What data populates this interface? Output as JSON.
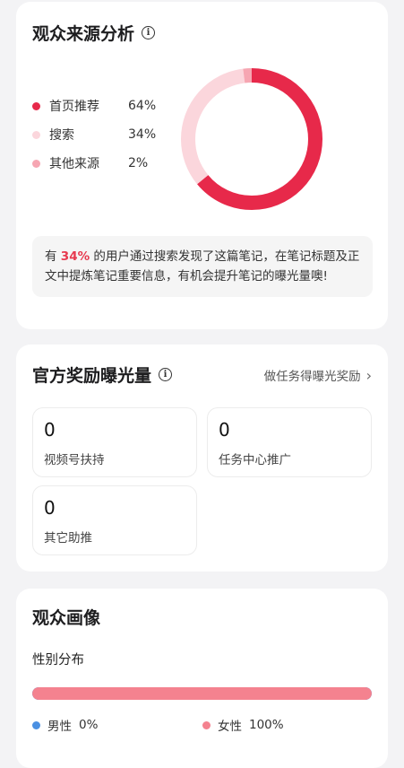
{
  "audience_source": {
    "title": "观众来源分析",
    "items": [
      {
        "label": "首页推荐",
        "value": "64%",
        "color": "#e7294a"
      },
      {
        "label": "搜索",
        "value": "34%",
        "color": "#fbd6dc"
      },
      {
        "label": "其他来源",
        "value": "2%",
        "color": "#f6a6b2"
      }
    ],
    "note": {
      "prefix": "有 ",
      "highlight": "34%",
      "suffix": " 的用户通过搜索发现了这篇笔记，在笔记标题及正文中提炼笔记重要信息，有机会提升笔记的曝光量噢!"
    }
  },
  "chart_data": {
    "type": "pie",
    "categories": [
      "首页推荐",
      "搜索",
      "其他来源"
    ],
    "values": [
      64,
      34,
      2
    ],
    "colors": [
      "#e7294a",
      "#fbd6dc",
      "#f6a6b2"
    ]
  },
  "official_reward": {
    "title": "官方奖励曝光量",
    "link": "做任务得曝光奖励",
    "stats": [
      {
        "value": "0",
        "label": "视频号扶持"
      },
      {
        "value": "0",
        "label": "任务中心推广"
      },
      {
        "value": "0",
        "label": "其它助推"
      }
    ]
  },
  "audience_profile": {
    "title": "观众画像",
    "gender_title": "性别分布",
    "gender": [
      {
        "label": "男性",
        "value": "0%",
        "fraction": 0,
        "color": "#4a90e2"
      },
      {
        "label": "女性",
        "value": "100%",
        "fraction": 1,
        "color": "#f4828f"
      }
    ]
  }
}
